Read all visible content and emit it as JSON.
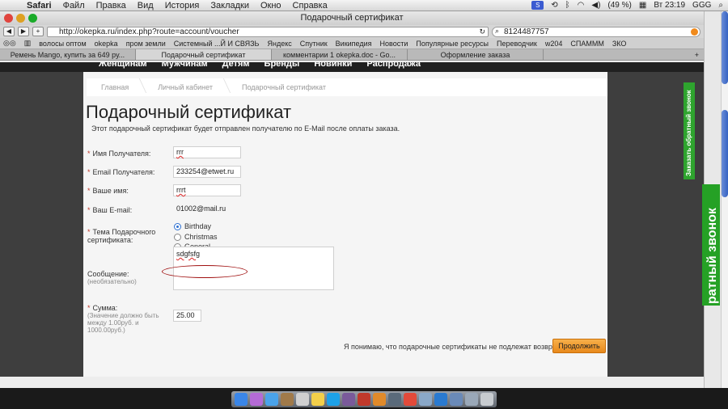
{
  "menubar": {
    "items": [
      "Safari",
      "Файл",
      "Правка",
      "Вид",
      "История",
      "Закладки",
      "Окно",
      "Справка"
    ],
    "battery": "(49 %)",
    "clock": "Вт 23:19",
    "user": "GGG"
  },
  "window": {
    "title": "Подарочный сертификат",
    "url": "http://okepka.ru/index.php?route=account/voucher",
    "search_value": "8124487757"
  },
  "bookmarks": [
    "волосы оптом",
    "okepka",
    "пром земли",
    "Системный ...Й И СВЯЗЬ",
    "Яндекс",
    "Спутник",
    "Википедия",
    "Новости",
    "Популярные ресурсы",
    "Переводчик",
    "w204",
    "СПАМММ",
    "ЗКО"
  ],
  "tabs": [
    "Ремень Mango, купить за 649 ру...",
    "Подарочный сертификат",
    "комментарии 1 okepka.doc - Go...",
    "Оформление заказа"
  ],
  "topnav": [
    "Женщинам",
    "Мужчинам",
    "Детям",
    "Бренды",
    "Новинки",
    "Распродажа"
  ],
  "breadcrumb": [
    "Главная",
    "Личный кабинет",
    "Подарочный сертификат"
  ],
  "page": {
    "title": "Подарочный сертификат",
    "intro": "Этот подарочный сертификат будет отправлен получателю по E-Mail после оплаты заказа."
  },
  "form": {
    "recipient_name_label": "Имя Получателя:",
    "recipient_name_value": "rrr",
    "recipient_email_label": "Email Получателя:",
    "recipient_email_value": "233254@etwet.ru",
    "your_name_label": "Ваше имя:",
    "your_name_value": "rrrt",
    "your_email_label": "Ваш E-mail:",
    "your_email_value": "01002@mail.ru",
    "theme_label": "Тема Подарочного сертификата:",
    "themes": [
      "Birthday",
      "Christmas",
      "General"
    ],
    "selected_theme": "Birthday",
    "message_label": "Сообщение:",
    "message_hint": "(необязательно)",
    "message_value": "sdgfsfg",
    "amount_label": "Сумма:",
    "amount_hint": "(Значение должно быть между 1.00руб. и 1000.00руб.)",
    "amount_value": "25.00",
    "agree_text": "Я понимаю, что подарочные сертификаты не подлежат возврату.",
    "submit_label": "Продолжить"
  },
  "widgets": {
    "callback_small": "Заказать обратный звонок",
    "callback_big": "ратный звонок"
  },
  "colors": {
    "accent_orange": "#e8891c",
    "callback_green": "#2ea42e",
    "required_red": "#c0392b"
  }
}
